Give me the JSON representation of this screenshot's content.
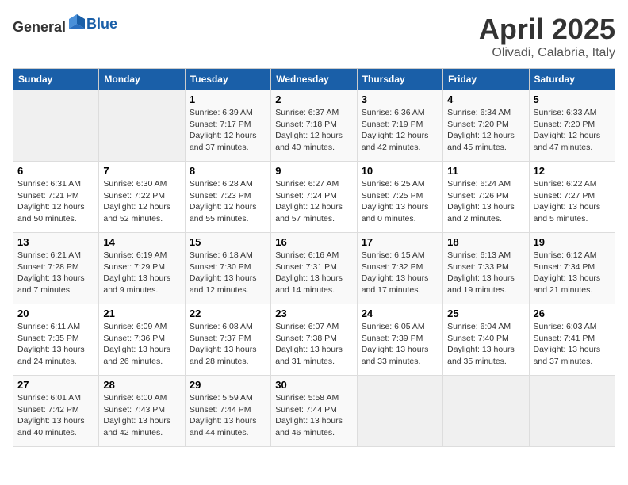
{
  "header": {
    "logo_general": "General",
    "logo_blue": "Blue",
    "month_year": "April 2025",
    "location": "Olivadi, Calabria, Italy"
  },
  "days_of_week": [
    "Sunday",
    "Monday",
    "Tuesday",
    "Wednesday",
    "Thursday",
    "Friday",
    "Saturday"
  ],
  "weeks": [
    [
      {
        "day": "",
        "sunrise": "",
        "sunset": "",
        "daylight": ""
      },
      {
        "day": "",
        "sunrise": "",
        "sunset": "",
        "daylight": ""
      },
      {
        "day": "1",
        "sunrise": "Sunrise: 6:39 AM",
        "sunset": "Sunset: 7:17 PM",
        "daylight": "Daylight: 12 hours and 37 minutes."
      },
      {
        "day": "2",
        "sunrise": "Sunrise: 6:37 AM",
        "sunset": "Sunset: 7:18 PM",
        "daylight": "Daylight: 12 hours and 40 minutes."
      },
      {
        "day": "3",
        "sunrise": "Sunrise: 6:36 AM",
        "sunset": "Sunset: 7:19 PM",
        "daylight": "Daylight: 12 hours and 42 minutes."
      },
      {
        "day": "4",
        "sunrise": "Sunrise: 6:34 AM",
        "sunset": "Sunset: 7:20 PM",
        "daylight": "Daylight: 12 hours and 45 minutes."
      },
      {
        "day": "5",
        "sunrise": "Sunrise: 6:33 AM",
        "sunset": "Sunset: 7:20 PM",
        "daylight": "Daylight: 12 hours and 47 minutes."
      }
    ],
    [
      {
        "day": "6",
        "sunrise": "Sunrise: 6:31 AM",
        "sunset": "Sunset: 7:21 PM",
        "daylight": "Daylight: 12 hours and 50 minutes."
      },
      {
        "day": "7",
        "sunrise": "Sunrise: 6:30 AM",
        "sunset": "Sunset: 7:22 PM",
        "daylight": "Daylight: 12 hours and 52 minutes."
      },
      {
        "day": "8",
        "sunrise": "Sunrise: 6:28 AM",
        "sunset": "Sunset: 7:23 PM",
        "daylight": "Daylight: 12 hours and 55 minutes."
      },
      {
        "day": "9",
        "sunrise": "Sunrise: 6:27 AM",
        "sunset": "Sunset: 7:24 PM",
        "daylight": "Daylight: 12 hours and 57 minutes."
      },
      {
        "day": "10",
        "sunrise": "Sunrise: 6:25 AM",
        "sunset": "Sunset: 7:25 PM",
        "daylight": "Daylight: 13 hours and 0 minutes."
      },
      {
        "day": "11",
        "sunrise": "Sunrise: 6:24 AM",
        "sunset": "Sunset: 7:26 PM",
        "daylight": "Daylight: 13 hours and 2 minutes."
      },
      {
        "day": "12",
        "sunrise": "Sunrise: 6:22 AM",
        "sunset": "Sunset: 7:27 PM",
        "daylight": "Daylight: 13 hours and 5 minutes."
      }
    ],
    [
      {
        "day": "13",
        "sunrise": "Sunrise: 6:21 AM",
        "sunset": "Sunset: 7:28 PM",
        "daylight": "Daylight: 13 hours and 7 minutes."
      },
      {
        "day": "14",
        "sunrise": "Sunrise: 6:19 AM",
        "sunset": "Sunset: 7:29 PM",
        "daylight": "Daylight: 13 hours and 9 minutes."
      },
      {
        "day": "15",
        "sunrise": "Sunrise: 6:18 AM",
        "sunset": "Sunset: 7:30 PM",
        "daylight": "Daylight: 13 hours and 12 minutes."
      },
      {
        "day": "16",
        "sunrise": "Sunrise: 6:16 AM",
        "sunset": "Sunset: 7:31 PM",
        "daylight": "Daylight: 13 hours and 14 minutes."
      },
      {
        "day": "17",
        "sunrise": "Sunrise: 6:15 AM",
        "sunset": "Sunset: 7:32 PM",
        "daylight": "Daylight: 13 hours and 17 minutes."
      },
      {
        "day": "18",
        "sunrise": "Sunrise: 6:13 AM",
        "sunset": "Sunset: 7:33 PM",
        "daylight": "Daylight: 13 hours and 19 minutes."
      },
      {
        "day": "19",
        "sunrise": "Sunrise: 6:12 AM",
        "sunset": "Sunset: 7:34 PM",
        "daylight": "Daylight: 13 hours and 21 minutes."
      }
    ],
    [
      {
        "day": "20",
        "sunrise": "Sunrise: 6:11 AM",
        "sunset": "Sunset: 7:35 PM",
        "daylight": "Daylight: 13 hours and 24 minutes."
      },
      {
        "day": "21",
        "sunrise": "Sunrise: 6:09 AM",
        "sunset": "Sunset: 7:36 PM",
        "daylight": "Daylight: 13 hours and 26 minutes."
      },
      {
        "day": "22",
        "sunrise": "Sunrise: 6:08 AM",
        "sunset": "Sunset: 7:37 PM",
        "daylight": "Daylight: 13 hours and 28 minutes."
      },
      {
        "day": "23",
        "sunrise": "Sunrise: 6:07 AM",
        "sunset": "Sunset: 7:38 PM",
        "daylight": "Daylight: 13 hours and 31 minutes."
      },
      {
        "day": "24",
        "sunrise": "Sunrise: 6:05 AM",
        "sunset": "Sunset: 7:39 PM",
        "daylight": "Daylight: 13 hours and 33 minutes."
      },
      {
        "day": "25",
        "sunrise": "Sunrise: 6:04 AM",
        "sunset": "Sunset: 7:40 PM",
        "daylight": "Daylight: 13 hours and 35 minutes."
      },
      {
        "day": "26",
        "sunrise": "Sunrise: 6:03 AM",
        "sunset": "Sunset: 7:41 PM",
        "daylight": "Daylight: 13 hours and 37 minutes."
      }
    ],
    [
      {
        "day": "27",
        "sunrise": "Sunrise: 6:01 AM",
        "sunset": "Sunset: 7:42 PM",
        "daylight": "Daylight: 13 hours and 40 minutes."
      },
      {
        "day": "28",
        "sunrise": "Sunrise: 6:00 AM",
        "sunset": "Sunset: 7:43 PM",
        "daylight": "Daylight: 13 hours and 42 minutes."
      },
      {
        "day": "29",
        "sunrise": "Sunrise: 5:59 AM",
        "sunset": "Sunset: 7:44 PM",
        "daylight": "Daylight: 13 hours and 44 minutes."
      },
      {
        "day": "30",
        "sunrise": "Sunrise: 5:58 AM",
        "sunset": "Sunset: 7:44 PM",
        "daylight": "Daylight: 13 hours and 46 minutes."
      },
      {
        "day": "",
        "sunrise": "",
        "sunset": "",
        "daylight": ""
      },
      {
        "day": "",
        "sunrise": "",
        "sunset": "",
        "daylight": ""
      },
      {
        "day": "",
        "sunrise": "",
        "sunset": "",
        "daylight": ""
      }
    ]
  ]
}
